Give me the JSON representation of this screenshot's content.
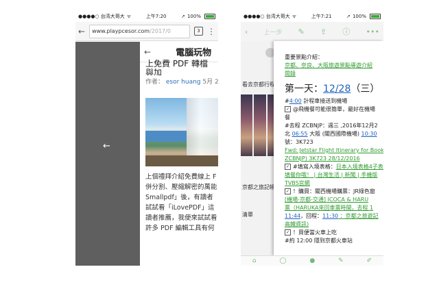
{
  "left_phone": {
    "status": {
      "carrier": "●●●●○ 台湾大哥大",
      "wifi": "ᯤ",
      "time": "上午7:20",
      "battery": "100%",
      "arrow": "➚"
    },
    "browser": {
      "back": "←",
      "url_main": "www.playpcesor.com",
      "url_rest": "/2017/0",
      "tabs_count": "3",
      "menu": "⋮"
    },
    "drawer_arrow": "←",
    "app_header": {
      "back": "←",
      "title": "電腦玩物"
    },
    "article": {
      "title_line1": "上免費 PDF 轉檔與加",
      "title_line2": "具",
      "author_prefix": "作者：",
      "author_name": "esor huang",
      "author_date": "5月 2"
    },
    "body_lines": [
      "上個禮拜介紹免費線上 F",
      "併分割、壓縮解密的萬能",
      "Smallpdf」後，有讀者",
      "試試看「iLovePDF」這",
      "讀者推薦，我便來試試看",
      "許多 PDF 編輯工具有何"
    ]
  },
  "right_phone": {
    "status": {
      "carrier": "●●●●○ 台湾大哥大",
      "wifi": "ᯤ",
      "time": "上午7:21",
      "battery": "100%",
      "arrow": "➚"
    },
    "toolbar": {
      "back": "‹",
      "title": "上一步",
      "edit": "✎",
      "share": "⇪",
      "info": "ⓘ",
      "more": "•••"
    },
    "background": {
      "text1": "看去京都行程",
      "text2": "京都之旅記帳",
      "text3": "清單"
    },
    "note": {
      "intro": "重要景點介紹：",
      "intro_link1": "京都、奈良、大阪旅遊景點導遊介紹",
      "intro_link2": "閱錄",
      "day_label": "第一天：",
      "day_date": "12/28",
      "day_weekday": "（三）",
      "l1_pre": "#",
      "l1_time": "4:00",
      "l1_post": " 計程車接送到機場",
      "l2": "@飛機餐可能很簡單，最好在機場",
      "l3": "餐",
      "l4": "#去程 ZCBNJP：週三 ,2016年12月2",
      "l5_pre": "北 ",
      "l5_t1": "06:55",
      "l5_mid": " 大阪 (關西國際機場) ",
      "l5_t2": "10:30",
      "l6": "號：3K723",
      "l7": "Fwd: Jetstar Flight Itinerary for Book",
      "l8": "ZCBNJP) 3K723 28/12/2016",
      "l9_pre": "#填寫入境表格：",
      "l9_link": "日本入境表格4子表",
      "l10": "填餐你哦！ | 台灣生活 | 新聞 | 手機版",
      "l11": "TVBS官網",
      "l12": "！購買：關西機場購票：JR綠色窗",
      "l13": "[機場-京都-交通] ICOCA & HARU",
      "l14": "票（HARUKA來回車票時間，去程 1",
      "l15_t1": "11:44",
      "l15_mid": "，回程：",
      "l15_t2": "11:30",
      "l15_post": " ：京都之旅遊記",
      "l16": "高鐵資訊)",
      "l17": "！買便當火車上吃",
      "l18": "#約 12:00 隱到京都火車站"
    },
    "bottom_icons": [
      "⌂",
      "◯",
      "●",
      "✎",
      "✐"
    ]
  }
}
